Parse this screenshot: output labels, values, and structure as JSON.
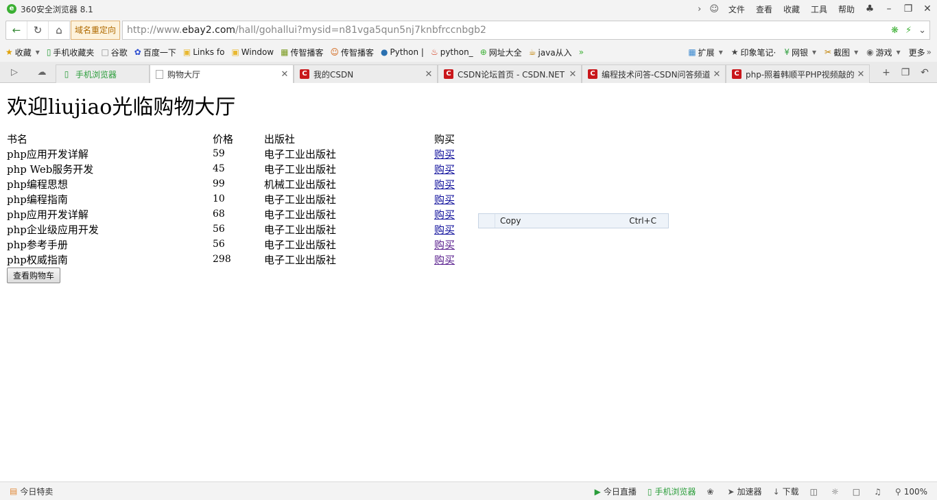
{
  "window": {
    "title": "360安全浏览器 8.1",
    "menu": [
      "文件",
      "查看",
      "收藏",
      "工具",
      "帮助"
    ]
  },
  "address": {
    "redirect_badge": "域名重定向",
    "url_prefix": "http://www.",
    "url_host": "ebay2.com",
    "url_path": "/hall/gohallui?mysid=n81vga5qun5nj7knbfrccnbgb2"
  },
  "bookmarks": {
    "items": [
      "收藏",
      "手机收藏夹",
      "谷歌",
      "百度一下",
      "Links fo",
      "Window",
      "传智播客",
      "传智播客",
      "Python |",
      "python_",
      "网址大全",
      "java从入"
    ],
    "right": [
      "扩展",
      "印象笔记·",
      "网银",
      "截图",
      "游戏",
      "更多"
    ]
  },
  "tabs": [
    {
      "title": "手机浏览器"
    },
    {
      "title": "购物大厅"
    },
    {
      "title": "我的CSDN"
    },
    {
      "title": "CSDN论坛首页 - CSDN.NET"
    },
    {
      "title": "编程技术问答-CSDN问答频道"
    },
    {
      "title": "php-照着韩顺平PHP视频敲的"
    }
  ],
  "page": {
    "heading": "欢迎liujiao光临购物大厅",
    "columns": [
      "书名",
      "价格",
      "出版社",
      "购买"
    ],
    "books": [
      {
        "name": "php应用开发详解",
        "price": "59",
        "publisher": "电子工业出版社",
        "buy": "购买"
      },
      {
        "name": "php Web服务开发",
        "price": "45",
        "publisher": "电子工业出版社",
        "buy": "购买"
      },
      {
        "name": "php编程思想",
        "price": "99",
        "publisher": "机械工业出版社",
        "buy": "购买"
      },
      {
        "name": "php编程指南",
        "price": "10",
        "publisher": "电子工业出版社",
        "buy": "购买"
      },
      {
        "name": "php应用开发详解",
        "price": "68",
        "publisher": "电子工业出版社",
        "buy": "购买"
      },
      {
        "name": "php企业级应用开发",
        "price": "56",
        "publisher": "电子工业出版社",
        "buy": "购买"
      },
      {
        "name": "php参考手册",
        "price": "56",
        "publisher": "电子工业出版社",
        "buy": "购买"
      },
      {
        "name": "php权威指南",
        "price": "298",
        "publisher": "电子工业出版社",
        "buy": "购买"
      }
    ],
    "cart_button": "查看购物车"
  },
  "context_menu": {
    "label": "Copy",
    "shortcut": "Ctrl+C"
  },
  "status": {
    "left": "今日特卖",
    "live": "今日直播",
    "mobile": "手机浏览器",
    "accelerator": "加速器",
    "download": "下载",
    "zoom": "100%"
  }
}
